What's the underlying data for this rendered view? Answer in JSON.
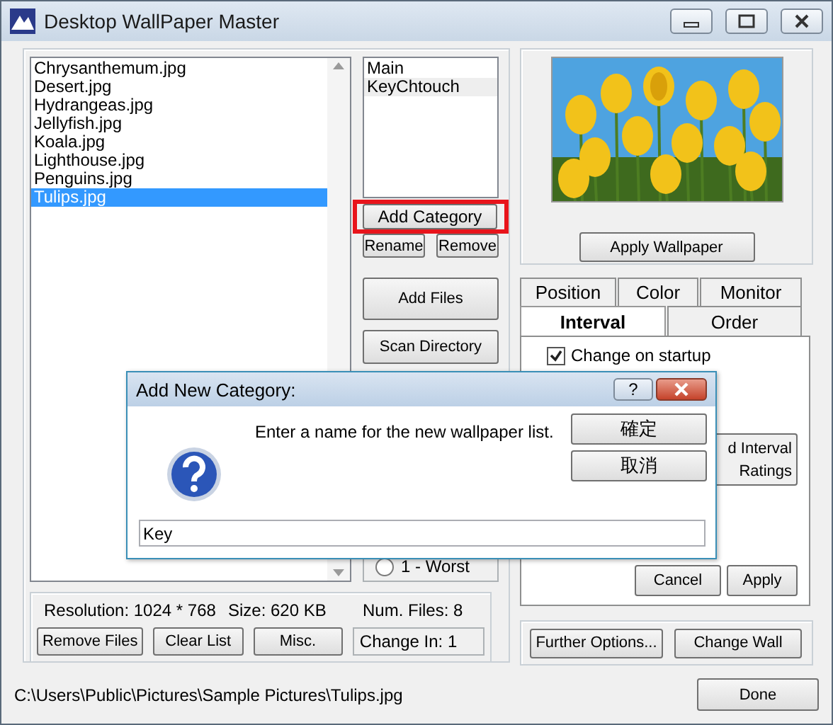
{
  "window": {
    "title": "Desktop WallPaper Master"
  },
  "files": [
    {
      "name": "Chrysanthemum.jpg",
      "selected": false
    },
    {
      "name": "Desert.jpg",
      "selected": false
    },
    {
      "name": "Hydrangeas.jpg",
      "selected": false
    },
    {
      "name": "Jellyfish.jpg",
      "selected": false
    },
    {
      "name": "Koala.jpg",
      "selected": false
    },
    {
      "name": "Lighthouse.jpg",
      "selected": false
    },
    {
      "name": "Penguins.jpg",
      "selected": false
    },
    {
      "name": "Tulips.jpg",
      "selected": true
    }
  ],
  "categories": [
    {
      "name": "Main",
      "selected": false
    },
    {
      "name": "KeyChtouch",
      "selected": true
    }
  ],
  "category_buttons": {
    "add": "Add Category",
    "rename": "Rename",
    "remove": "Remove"
  },
  "file_buttons": {
    "add": "Add Files",
    "scan": "Scan Directory"
  },
  "rating": {
    "label": "1 - Worst",
    "checked": false
  },
  "info": {
    "resolution": "Resolution: 1024 *  768",
    "size": "Size:  620 KB",
    "count": "Num. Files: 8"
  },
  "list_buttons": [
    "Remove Files",
    "Clear List",
    "Misc."
  ],
  "change_in": "Change In: 1",
  "preview": {
    "button": "Apply Wallpaper"
  },
  "tab_rows": [
    [
      {
        "label": "Position",
        "selected": false
      },
      {
        "label": "Color",
        "selected": false
      },
      {
        "label": "Monitor",
        "selected": false
      }
    ],
    [
      {
        "label": "Interval",
        "selected": true
      },
      {
        "label": "Order",
        "selected": false
      }
    ]
  ],
  "interval": {
    "startup": {
      "label": "Change on startup",
      "checked": true
    },
    "interval_button": [
      "d Interval",
      "Ratings"
    ],
    "cancel": "Cancel",
    "apply": "Apply"
  },
  "further": {
    "options": "Further Options...",
    "change": "Change Wall"
  },
  "status": {
    "path": "C:\\Users\\Public\\Pictures\\Sample Pictures\\Tulips.jpg",
    "done": "Done"
  },
  "dialog": {
    "title": "Add New Category:",
    "help": "?",
    "message": "Enter a name for the new wallpaper list.",
    "ok": "確定",
    "cancel": "取消",
    "value": "Key"
  }
}
